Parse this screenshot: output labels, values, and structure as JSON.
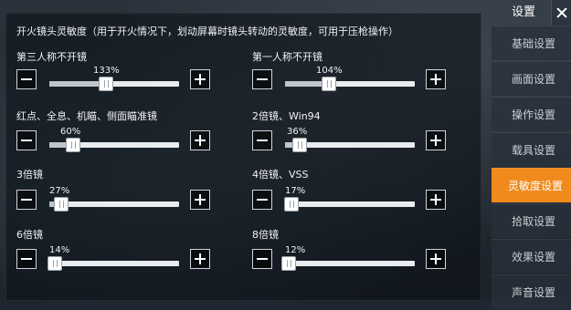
{
  "header": {
    "title": "开火镜头灵敏度（用于开火情况下，划动屏幕时镜头转动的灵敏度，可用于压枪操作）"
  },
  "sliders": [
    {
      "label": "第三人称不开镜",
      "value": "133%",
      "fraction": 0.44
    },
    {
      "label": "第一人称不开镜",
      "value": "104%",
      "fraction": 0.34
    },
    {
      "label": "红点、全息、机瞄、侧面瞄准镜",
      "value": "60%",
      "fraction": 0.18
    },
    {
      "label": "2倍镜、Win94",
      "value": "36%",
      "fraction": 0.11
    },
    {
      "label": "3倍镜",
      "value": "27%",
      "fraction": 0.09
    },
    {
      "label": "4倍镜、VSS",
      "value": "17%",
      "fraction": 0.05
    },
    {
      "label": "6倍镜",
      "value": "14%",
      "fraction": 0.04
    },
    {
      "label": "8倍镜",
      "value": "12%",
      "fraction": 0.03
    }
  ],
  "sidebar": {
    "title": "设置",
    "items": [
      {
        "label": "基础设置",
        "active": false
      },
      {
        "label": "画面设置",
        "active": false
      },
      {
        "label": "操作设置",
        "active": false
      },
      {
        "label": "载具设置",
        "active": false
      },
      {
        "label": "灵敏度设置",
        "active": true
      },
      {
        "label": "拾取设置",
        "active": false
      },
      {
        "label": "效果设置",
        "active": false
      },
      {
        "label": "声音设置",
        "active": false
      }
    ]
  },
  "colors": {
    "accent": "#f08a1c",
    "track": "#e9ecef"
  }
}
